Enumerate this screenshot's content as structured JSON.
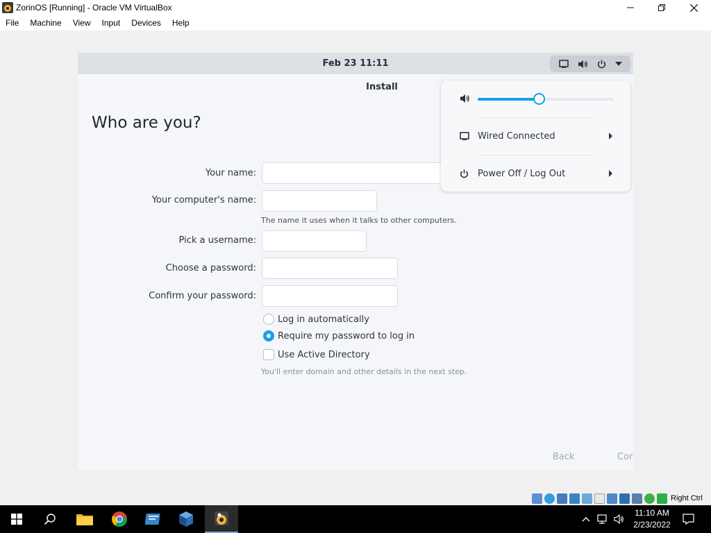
{
  "window": {
    "title": "ZorinOS [Running] - Oracle VM VirtualBox",
    "controls": {
      "minimize": "—",
      "maximize": "❐",
      "close": "✕"
    }
  },
  "menubar": [
    "File",
    "Machine",
    "View",
    "Input",
    "Devices",
    "Help"
  ],
  "guest": {
    "clock": "Feb 23  11:11",
    "dialog_title": "Install",
    "heading": "Who are you?",
    "form": {
      "your_name_label": "Your name:",
      "your_name_value": "",
      "computer_name_label": "Your computer's name:",
      "computer_name_value": "",
      "computer_name_hint": "The name it uses when it talks to other computers.",
      "username_label": "Pick a username:",
      "username_value": "",
      "password_label": "Choose a password:",
      "password_value": "",
      "confirm_label": "Confirm your password:",
      "confirm_value": "",
      "login_auto": "Log in automatically",
      "require_password": "Require my password to log in",
      "selected_login_option": "require_password",
      "active_directory": "Use Active Directory",
      "active_directory_checked": false,
      "active_directory_hint": "You'll enter domain and other details in the next step."
    },
    "buttons": {
      "back": "Back",
      "continue": "Cor"
    },
    "system_menu": {
      "volume_level": 0.45,
      "wired": "Wired Connected",
      "power": "Power Off / Log Out"
    }
  },
  "statusbar": {
    "host_key": "Right Ctrl"
  },
  "taskbar": {
    "time": "11:10 AM",
    "date": "2/23/2022"
  },
  "colors": {
    "accent": "#17a0e3",
    "taskbar": "#000000"
  }
}
